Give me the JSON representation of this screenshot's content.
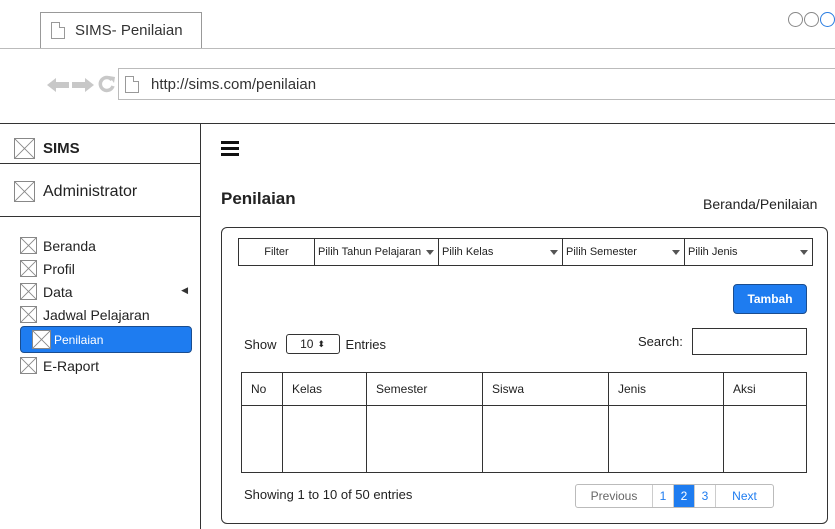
{
  "browser": {
    "tab_title": "SIMS- Penilaian",
    "url": "http://sims.com/penilaian"
  },
  "sidebar": {
    "brand": "SIMS",
    "user": "Administrator",
    "items": [
      {
        "label": "Beranda"
      },
      {
        "label": "Profil"
      },
      {
        "label": "Data"
      },
      {
        "label": "Jadwal Pelajaran"
      },
      {
        "label": "Penilaian",
        "active": true
      },
      {
        "label": "E-Raport"
      }
    ]
  },
  "header": {
    "menu_icon": "hamburger-icon"
  },
  "main": {
    "title": "Penilaian",
    "breadcrumb": "Beranda/Penilaian",
    "filters": {
      "label": "Filter",
      "tahun": "Pilih Tahun Pelajaran",
      "kelas": "Pilih Kelas",
      "semester": "Pilih Semester",
      "jenis": "Pilih Jenis"
    },
    "add_button": "Tambah",
    "show_label": "Show",
    "entries_value": "10",
    "entries_label": "Entries",
    "search_label": "Search:",
    "search_value": "",
    "table": {
      "columns": [
        "No",
        "Kelas",
        "Semester",
        "Siswa",
        "Jenis",
        "Aksi"
      ]
    },
    "showing_text": "Showing 1 to 10 of 50 entries",
    "pagination": {
      "previous": "Previous",
      "pages": [
        "1",
        "2",
        "3"
      ],
      "current": "2",
      "next": "Next"
    }
  },
  "colors": {
    "accent": "#1e7cf0"
  }
}
